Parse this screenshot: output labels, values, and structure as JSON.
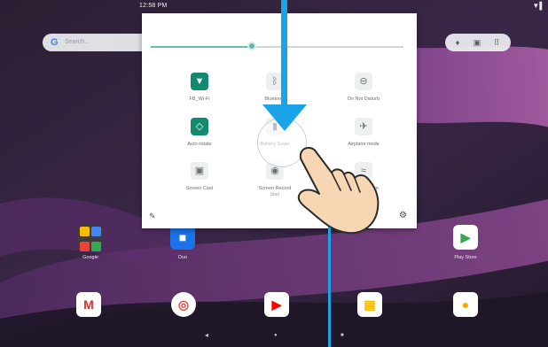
{
  "status_bar": {
    "time": "12:58 PM",
    "indicator": "▼▌"
  },
  "search": {
    "logo": "G",
    "placeholder": "Search..."
  },
  "brightness": {
    "level": 0.4
  },
  "quick_settings": {
    "tiles": [
      {
        "label": "FB_Wi-Fi",
        "sub": "",
        "icon": "wifi-icon",
        "glyph": "▼",
        "active": true
      },
      {
        "label": "Bluetooth",
        "sub": "",
        "icon": "bluetooth-icon",
        "glyph": "ᛒ",
        "active": false
      },
      {
        "label": "Do Not Disturb",
        "sub": "",
        "icon": "do-not-disturb-icon",
        "glyph": "⊖",
        "active": false
      },
      {
        "label": "Auto-rotate",
        "sub": "",
        "icon": "auto-rotate-icon",
        "glyph": "◇",
        "active": true
      },
      {
        "label": "Battery Saver",
        "sub": "",
        "icon": "battery-saver-icon",
        "glyph": "▮",
        "active": false
      },
      {
        "label": "Airplane mode",
        "sub": "",
        "icon": "airplane-icon",
        "glyph": "✈",
        "active": false
      },
      {
        "label": "Screen Cast",
        "sub": "",
        "icon": "screen-cast-icon",
        "glyph": "▣",
        "active": false
      },
      {
        "label": "Screen Record",
        "sub": "Start",
        "icon": "screen-record-icon",
        "glyph": "◉",
        "active": false
      },
      {
        "label": "Nearby Share",
        "sub": "",
        "icon": "nearby-share-icon",
        "glyph": "≈",
        "active": false
      }
    ]
  },
  "home_apps": [
    {
      "label": "Google",
      "icon": "google-folder-icon",
      "color": "#3b3b3b"
    },
    {
      "label": "Duo",
      "icon": "duo-icon",
      "color": "#1a73e8"
    },
    {
      "label": "Play Store",
      "icon": "play-store-icon",
      "color": "#ffffff"
    }
  ],
  "dock": [
    {
      "icon": "gmail-icon",
      "glyph": "M",
      "bg": "#ffffff",
      "fg": "#d93025"
    },
    {
      "icon": "chrome-icon",
      "glyph": "◎",
      "bg": "#ffffff",
      "fg": "#ea4335"
    },
    {
      "icon": "youtube-icon",
      "glyph": "▶",
      "bg": "#ffffff",
      "fg": "#ff0000"
    },
    {
      "icon": "slides-icon",
      "glyph": "▤",
      "bg": "#ffffff",
      "fg": "#f4b400"
    },
    {
      "icon": "camera-icon",
      "glyph": "●",
      "bg": "#ffffff",
      "fg": "#f9ab00"
    }
  ],
  "nav": {
    "back": "◂",
    "home": "●",
    "recents": "■"
  },
  "colors": {
    "accent": "#138a70",
    "arrow": "#1aa3e8"
  }
}
